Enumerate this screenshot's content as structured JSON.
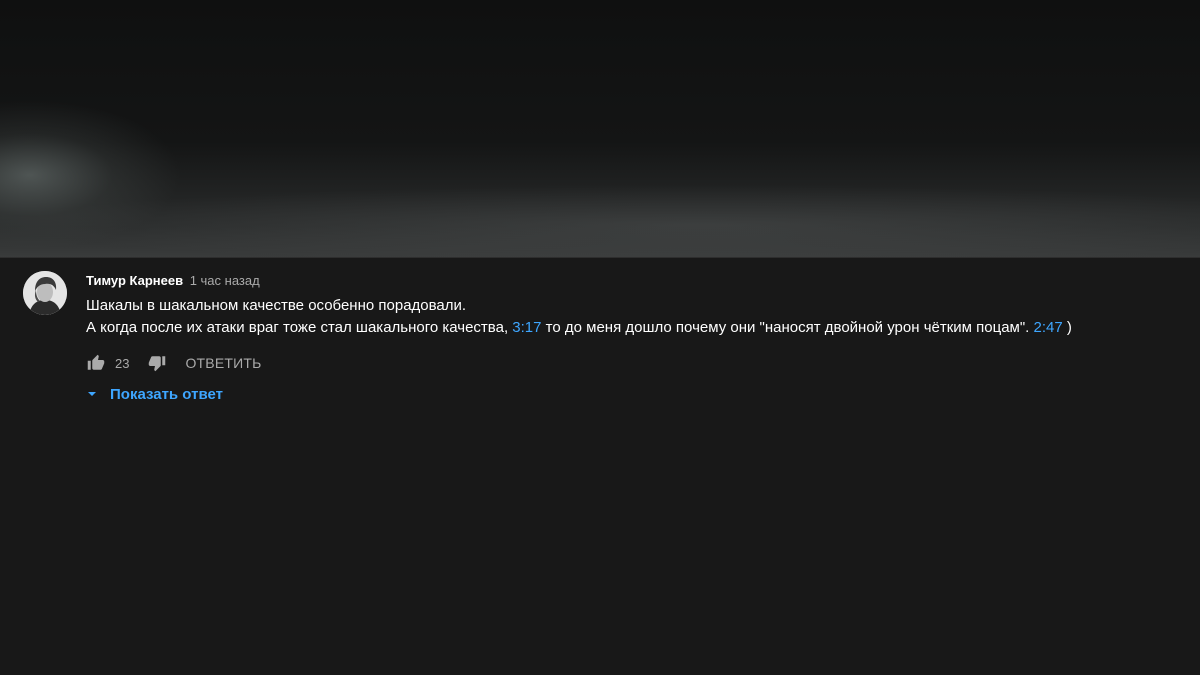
{
  "comment": {
    "author": "Тимур Карнеев",
    "timestamp": "1 час назад",
    "line1": "Шакалы в шакальном качестве особенно порадовали.",
    "line2_part1": "А когда после их атаки враг тоже стал шакального качества, ",
    "timecode1": "3:17",
    "line2_part2": " то до меня дошло почему они \"наносят двойной урон чётким поцам\". ",
    "timecode2": "2:47",
    "line2_part3": " )",
    "likes": "23",
    "reply_label": "ОТВЕТИТЬ",
    "show_replies_label": "Показать ответ"
  },
  "icons": {
    "like": "thumb-up-icon",
    "dislike": "thumb-down-icon",
    "expand": "caret-down-icon"
  },
  "colors": {
    "background": "#181818",
    "link": "#3ea6ff",
    "secondary_text": "#aaaaaa",
    "primary_text": "#ffffff"
  }
}
